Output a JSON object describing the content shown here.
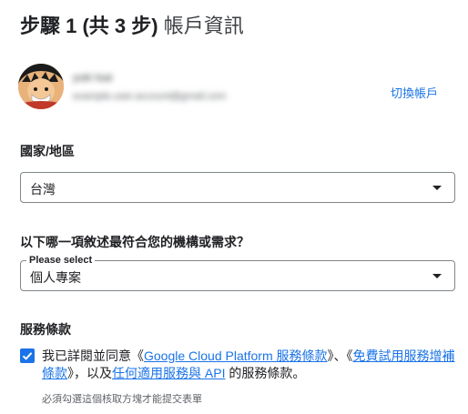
{
  "header": {
    "step": "步驟 1 (共 3 步)",
    "title": "帳戶資訊"
  },
  "account": {
    "name": "yuki tsai",
    "email": "example.user.account@gmail.com",
    "switch_label": "切換帳戶"
  },
  "country": {
    "label": "國家/地區",
    "value": "台灣"
  },
  "needs": {
    "label": "以下哪一項敘述最符合您的機構或需求？",
    "field_label": "Please select",
    "value": "個人專案"
  },
  "terms": {
    "heading": "服務條款",
    "checked": true,
    "text_before": "我已詳閱並同意《",
    "link1": "Google Cloud Platform 服務條款",
    "text_mid1": "》、《",
    "link2": "免費試用服務增補條款",
    "text_mid2": "》，以及",
    "link3": "任何適用服務與 API",
    "text_after": " 的服務條款。",
    "hint": "必須勾選這個核取方塊才能提交表單"
  },
  "colors": {
    "accent": "#1a73e8",
    "text": "#202124",
    "border": "#80868b"
  }
}
